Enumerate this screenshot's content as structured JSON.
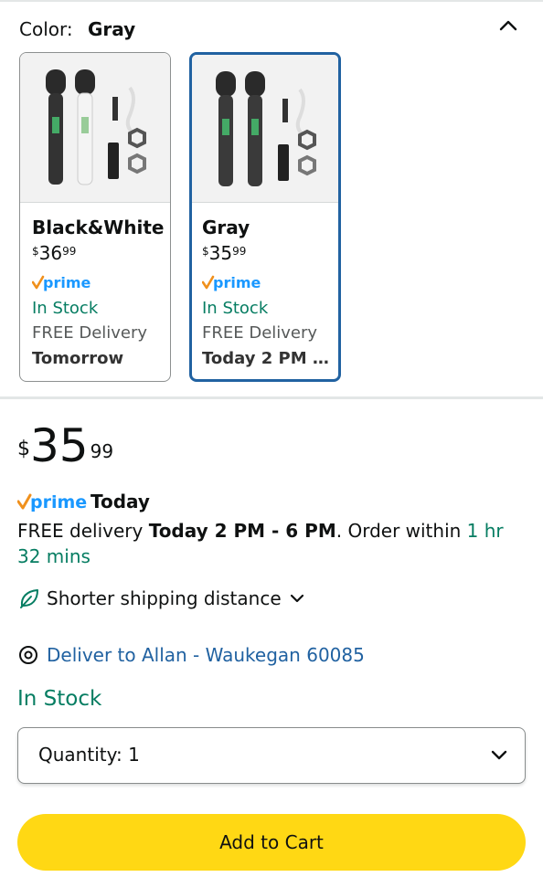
{
  "color_selector": {
    "label": "Color:",
    "value": "Gray",
    "options": [
      {
        "name": "Black&White",
        "price_currency": "$",
        "price_whole": "36",
        "price_cents": "99",
        "prime": "prime",
        "stock": "In Stock",
        "delivery": "FREE Delivery",
        "when": "Tomorrow",
        "selected": false
      },
      {
        "name": "Gray",
        "price_currency": "$",
        "price_whole": "35",
        "price_cents": "99",
        "prime": "prime",
        "stock": "In Stock",
        "delivery": "FREE Delivery",
        "when": "Today 2 PM …",
        "selected": true
      }
    ]
  },
  "price": {
    "currency": "$",
    "whole": "35",
    "cents": "99"
  },
  "prime_badge": {
    "prime": "prime",
    "today": "Today"
  },
  "delivery": {
    "prefix": "FREE delivery ",
    "window": "Today 2 PM - 6 PM",
    "mid": ". Order within ",
    "countdown": "1 hr 32 mins"
  },
  "shipping_note": {
    "label": "Shorter shipping distance",
    "icon": "leaf-icon"
  },
  "deliver_to": {
    "label": "Deliver to Allan - Waukegan 60085",
    "icon": "location-pin-icon"
  },
  "stock_status": "In Stock",
  "quantity": {
    "label": "Quantity:",
    "value": "1"
  },
  "add_to_cart": {
    "label": "Add to Cart"
  },
  "colors": {
    "link_blue": "#2162a1",
    "stock_green": "#067d62",
    "cart_yellow": "#ffd814",
    "prime_check_orange": "#f0901c",
    "prime_blue": "#1a98ff"
  }
}
